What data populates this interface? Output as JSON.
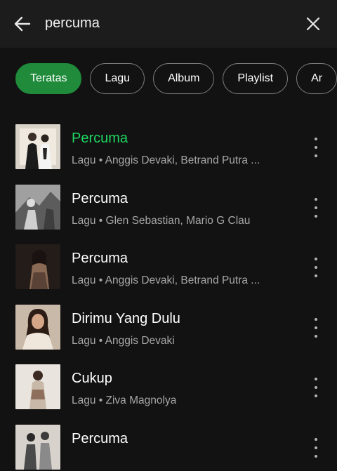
{
  "search": {
    "query": "percuma"
  },
  "filters": [
    "Teratas",
    "Lagu",
    "Album",
    "Playlist",
    "Ar"
  ],
  "results": [
    {
      "title": "Percuma",
      "subtitle": "Lagu • Anggis Devaki, Betrand Putra ...",
      "playing": true
    },
    {
      "title": "Percuma",
      "subtitle": "Lagu • Glen Sebastian, Mario G Clau",
      "playing": false
    },
    {
      "title": "Percuma",
      "subtitle": "Lagu • Anggis Devaki, Betrand Putra ...",
      "playing": false
    },
    {
      "title": "Dirimu Yang Dulu",
      "subtitle": "Lagu • Anggis Devaki",
      "playing": false
    },
    {
      "title": "Cukup",
      "subtitle": "Lagu • Ziva Magnolya",
      "playing": false
    },
    {
      "title": "Percuma",
      "subtitle": "",
      "playing": false
    }
  ],
  "colors": {
    "accent": "#1ed760",
    "chip_active": "#1f8b3b",
    "background": "#121212",
    "header": "#1c1c1c",
    "secondary_text": "#a7a7a7"
  },
  "icons": {
    "back": "arrow-left-icon",
    "close": "close-icon",
    "more": "more-vertical-icon"
  }
}
